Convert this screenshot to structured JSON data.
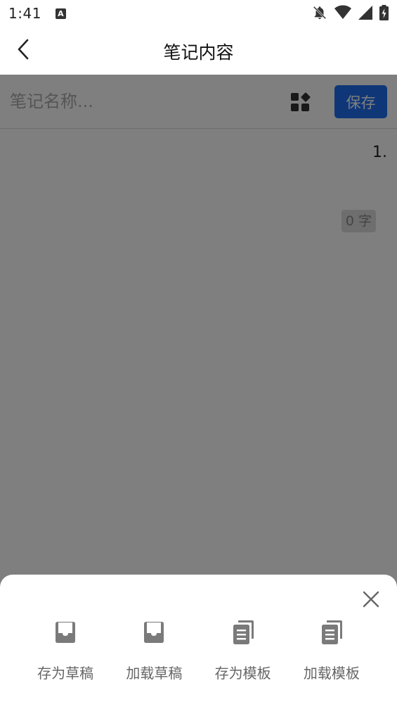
{
  "status_bar": {
    "time": "1:41",
    "app_icon_letter": "A",
    "icons": [
      "notifications-off-icon",
      "wifi-icon",
      "signal-icon",
      "battery-charging-icon"
    ]
  },
  "app_bar": {
    "back_icon": "chevron-left-icon",
    "title": "笔记内容"
  },
  "editor": {
    "name_placeholder": "笔记名称...",
    "name_value": "",
    "apps_icon": "apps-grid-icon",
    "save_label": "保存",
    "line_number": "1.",
    "word_count": "0 字"
  },
  "bottom_sheet": {
    "close_icon": "close-icon",
    "actions": [
      {
        "label": "存为草稿",
        "icon": "inbox-tray-icon"
      },
      {
        "label": "加载草稿",
        "icon": "inbox-tray-icon"
      },
      {
        "label": "存为模板",
        "icon": "copy-document-icon"
      },
      {
        "label": "加载模板",
        "icon": "copy-document-icon"
      }
    ]
  },
  "colors": {
    "accent": "#1e6ff0",
    "overlay": "rgba(0,0,0,0.5)",
    "icon_gray": "#7a7a7a"
  }
}
